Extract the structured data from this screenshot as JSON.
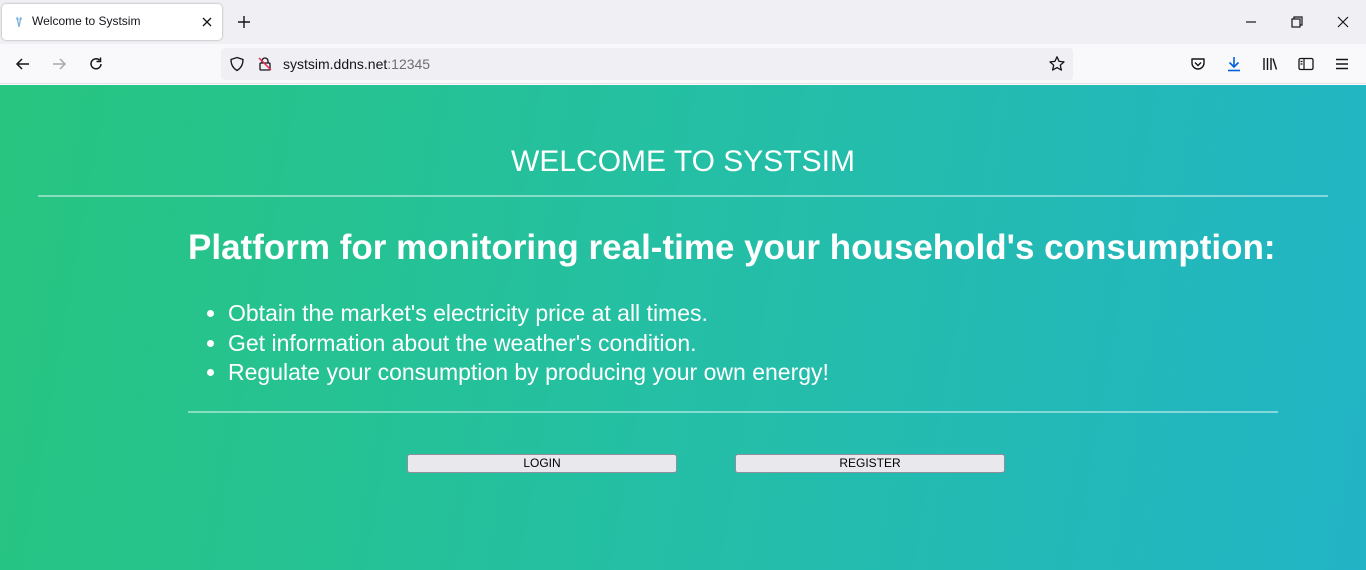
{
  "browser": {
    "tab": {
      "title": "Welcome to Systsim"
    },
    "url": {
      "host": "systsim.ddns.net",
      "port": ":12345"
    },
    "colors": {
      "download_icon": "#0060df"
    }
  },
  "page": {
    "welcome_title": "WELCOME TO SYSTSIM",
    "headline": "Platform for monitoring real-time your household's consumption:",
    "features": [
      "Obtain the market's electricity price at all times.",
      "Get information about the weather's condition.",
      "Regulate your consumption by producing your own energy!"
    ],
    "buttons": {
      "login": "LOGIN",
      "register": "REGISTER"
    },
    "gradient": {
      "start": "#27c57f",
      "end": "#22b4c6"
    }
  }
}
